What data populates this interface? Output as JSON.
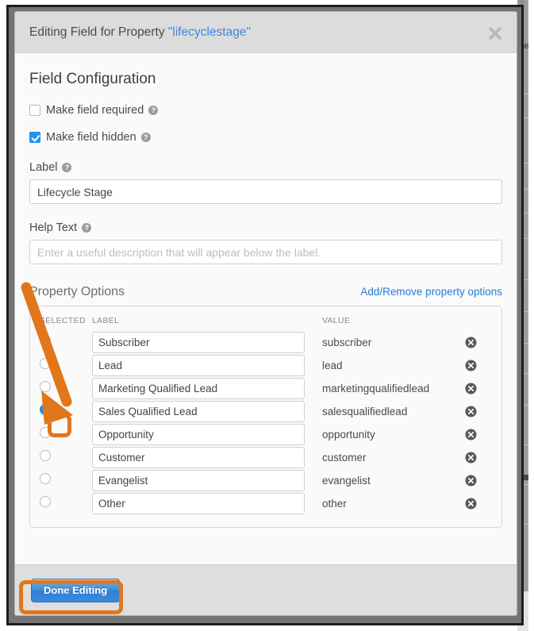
{
  "modal": {
    "title_prefix": "Editing Field for Property ",
    "title_property": "\"lifecyclestage\"",
    "close_icon": "close-icon",
    "section_title": "Field Configuration",
    "checkboxes": [
      {
        "label": "Make field required",
        "checked": false,
        "help_icon": "help-icon"
      },
      {
        "label": "Make field hidden",
        "checked": true,
        "help_icon": "help-icon"
      }
    ],
    "label_field": {
      "label": "Label",
      "value": "Lifecycle Stage",
      "placeholder": "",
      "help_icon": "help-icon"
    },
    "help_text_field": {
      "label": "Help Text",
      "value": "",
      "placeholder": "Enter a useful description that will appear below the label.",
      "help_icon": "help-icon"
    },
    "property_options": {
      "title": "Property Options",
      "link": "Add/Remove property options",
      "columns": [
        "SELECTED",
        "LABEL",
        "VALUE"
      ],
      "delete_icon": "delete-circle-icon",
      "rows": [
        {
          "label": "Subscriber",
          "value": "subscriber",
          "selected": false
        },
        {
          "label": "Lead",
          "value": "lead",
          "selected": false
        },
        {
          "label": "Marketing Qualified Lead",
          "value": "marketingqualifiedlead",
          "selected": false
        },
        {
          "label": "Sales Qualified Lead",
          "value": "salesqualifiedlead",
          "selected": true
        },
        {
          "label": "Opportunity",
          "value": "opportunity",
          "selected": false
        },
        {
          "label": "Customer",
          "value": "customer",
          "selected": false
        },
        {
          "label": "Evangelist",
          "value": "evangelist",
          "selected": false
        },
        {
          "label": "Other",
          "value": "other",
          "selected": false
        }
      ]
    },
    "footer": {
      "done_label": "Done Editing"
    }
  },
  "background": {
    "clipped_text": "ue"
  },
  "annotation": {
    "color": "#E2761B",
    "arrow_icon": "arrow-pointer",
    "highlight_radio": "selected-radio-highlight",
    "highlight_button": "done-editing-highlight"
  }
}
